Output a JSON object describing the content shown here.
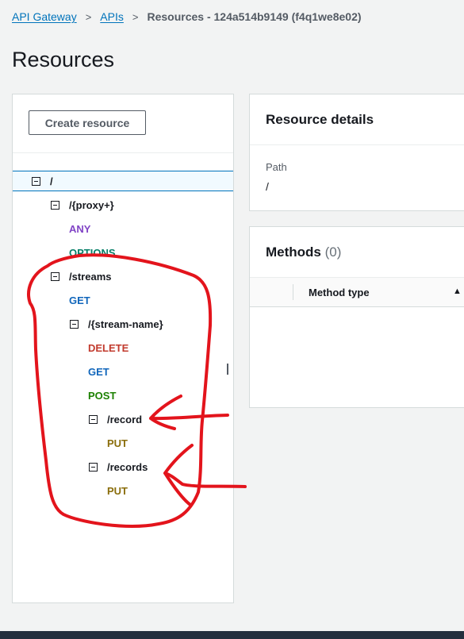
{
  "breadcrumb": {
    "items": [
      "API Gateway",
      "APIs"
    ],
    "current": "Resources - 124a514b9149 (f4q1we8e02)",
    "separator": ">"
  },
  "page": {
    "title": "Resources"
  },
  "tree": {
    "create_label": "Create resource",
    "nodes": [
      {
        "label": "/",
        "kind": "resource"
      },
      {
        "label": "/{proxy+}",
        "kind": "resource"
      },
      {
        "label": "ANY",
        "kind": "method"
      },
      {
        "label": "OPTIONS",
        "kind": "method"
      },
      {
        "label": "/streams",
        "kind": "resource"
      },
      {
        "label": "GET",
        "kind": "method"
      },
      {
        "label": "/{stream-name}",
        "kind": "resource"
      },
      {
        "label": "DELETE",
        "kind": "method"
      },
      {
        "label": "GET",
        "kind": "method"
      },
      {
        "label": "POST",
        "kind": "method"
      },
      {
        "label": "/record",
        "kind": "resource"
      },
      {
        "label": "PUT",
        "kind": "method"
      },
      {
        "label": "/records",
        "kind": "resource"
      },
      {
        "label": "PUT",
        "kind": "method"
      }
    ]
  },
  "details": {
    "title": "Resource details",
    "path_label": "Path",
    "path_value": "/"
  },
  "methods": {
    "title": "Methods",
    "count": "(0)",
    "column_method_type": "Method type",
    "sort_icon": "▲"
  },
  "colors": {
    "link": "#0073bb",
    "annotation": "#e3141c",
    "method_any": "#8144c6",
    "method_options": "#067f68",
    "method_get": "#1166bb",
    "method_delete": "#c23b2e",
    "method_post": "#1d8102",
    "method_put": "#8a6d0b"
  }
}
